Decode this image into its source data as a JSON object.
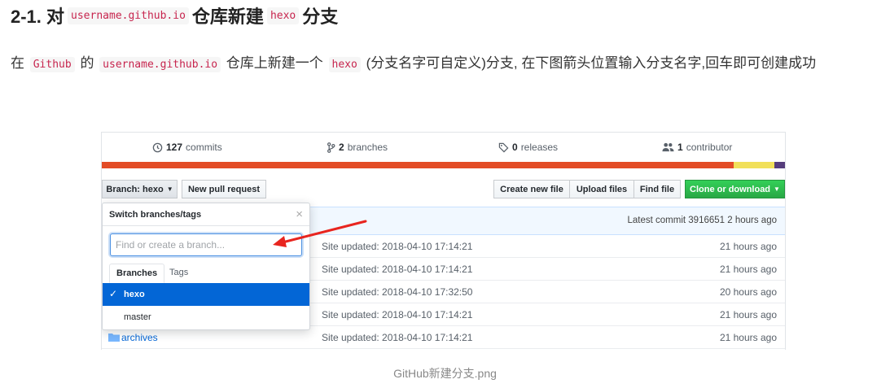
{
  "heading": {
    "prefix": "2-1. 对",
    "code1": "username.github.io",
    "middle": "仓库新建",
    "code2": "hexo",
    "suffix": "分支"
  },
  "paragraph": {
    "t1": "在",
    "c1": "Github",
    "t2": "的",
    "c2": "username.github.io",
    "t3": "仓库上新建一个",
    "c3": "hexo",
    "t4": "(分支名字可自定义)分支, 在下图箭头位置输入分支名字,回车即可创建成功"
  },
  "repo": {
    "summary": {
      "commits_count": "127",
      "commits_label": "commits",
      "branches_count": "2",
      "branches_label": "branches",
      "releases_count": "0",
      "releases_label": "releases",
      "contributors_count": "1",
      "contributors_label": "contributor"
    },
    "language_bar": {
      "colors": [
        "#e34c26",
        "#f1e05a",
        "#563d7c"
      ],
      "shares": [
        0.925,
        0.059,
        0.016
      ]
    },
    "buttons": {
      "branch": "Branch: hexo",
      "new_pull_request": "New pull request",
      "create_new_file": "Create new file",
      "upload_files": "Upload files",
      "find_file": "Find file",
      "clone_or_download": "Clone or download"
    },
    "latest_commit": "Latest commit 3916651 2 hours ago",
    "rows": [
      {
        "name": "",
        "message": "Site updated: 2018-04-10 17:14:21",
        "age": "21 hours ago"
      },
      {
        "name": "",
        "message": "Site updated: 2018-04-10 17:14:21",
        "age": "21 hours ago"
      },
      {
        "name": "",
        "message": "Site updated: 2018-04-10 17:32:50",
        "age": "20 hours ago"
      },
      {
        "name": "",
        "message": "Site updated: 2018-04-10 17:14:21",
        "age": "21 hours ago"
      },
      {
        "name": "archives",
        "message": "Site updated: 2018-04-10 17:14:21",
        "age": "21 hours ago"
      }
    ],
    "dropdown": {
      "title": "Switch branches/tags",
      "close": "×",
      "filter_placeholder": "Find or create a branch...",
      "tab_branches": "Branches",
      "tab_tags": "Tags",
      "branches": [
        {
          "name": "hexo",
          "selected": true
        },
        {
          "name": "master",
          "selected": false
        }
      ]
    }
  },
  "caption": "GitHub新建分支.png"
}
